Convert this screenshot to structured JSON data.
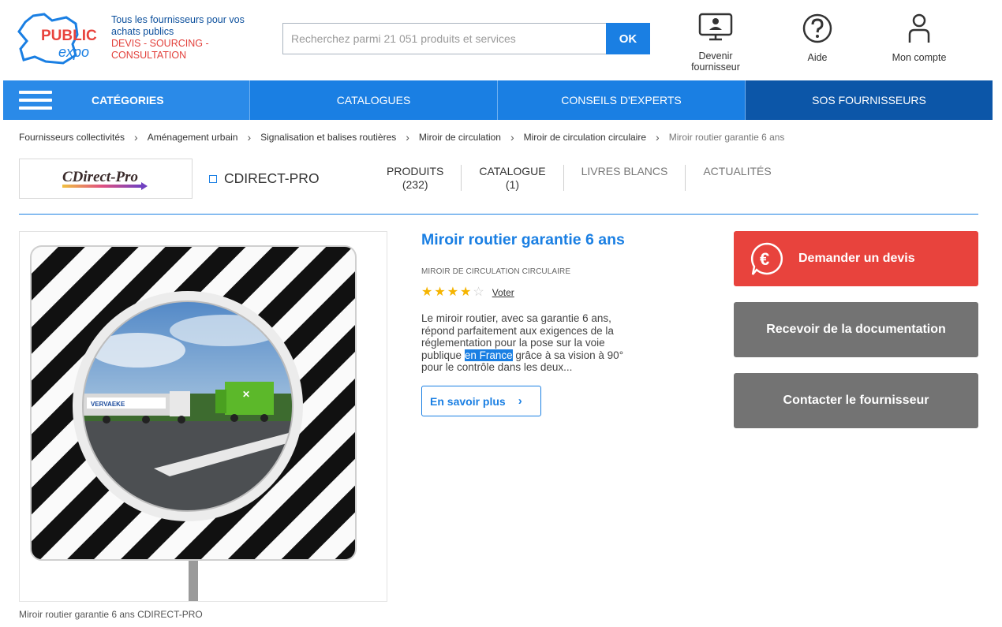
{
  "header": {
    "logo_line1": "PUBLIC",
    "logo_line2": "expo",
    "tagline1": "Tous les fournisseurs pour vos achats publics",
    "tagline2": "DEVIS - SOURCING - CONSULTATION",
    "search_placeholder": "Recherchez parmi 21 051 produits et services",
    "search_button": "OK",
    "links": {
      "become_supplier": "Devenir fournisseur",
      "help": "Aide",
      "account": "Mon compte"
    }
  },
  "nav": {
    "categories": "CATÉGORIES",
    "catalogues": "CATALOGUES",
    "experts": "CONSEILS D'EXPERTS",
    "sos": "SOS FOURNISSEURS"
  },
  "breadcrumb": {
    "b1": "Fournisseurs collectivités",
    "b2": "Aménagement urbain",
    "b3": "Signalisation et balises routières",
    "b4": "Miroir de circulation",
    "b5": "Miroir de circulation circulaire",
    "b6": "Miroir routier garantie 6 ans"
  },
  "supplier": {
    "logo_text": "CDirect-Pro",
    "name": "CDIRECT-PRO",
    "tabs": {
      "products_label": "PRODUITS",
      "products_count": "(232)",
      "catalogue_label": "CATALOGUE",
      "catalogue_count": "(1)",
      "whitepapers": "LIVRES BLANCS",
      "news": "ACTUALITÉS"
    }
  },
  "product": {
    "title": "Miroir routier garantie 6 ans",
    "category": "MIROIR DE CIRCULATION CIRCULAIRE",
    "rating": 4,
    "rating_max": 5,
    "vote_label": "Voter",
    "desc_before": "Le miroir routier, avec sa garantie 6 ans, répond parfaitement aux exigences de la réglementation pour la pose sur la voie publique ",
    "desc_highlight": "en France",
    "desc_after": " grâce à sa vision à 90° pour le contrôle dans les deux...",
    "more_label": "En savoir plus",
    "caption": "Miroir routier garantie 6 ans CDIRECT-PRO",
    "truck_text": "VERVAEKE"
  },
  "actions": {
    "quote": "Demander un devis",
    "documentation": "Recevoir de la documentation",
    "contact": "Contacter le fournisseur"
  },
  "colors": {
    "primary_blue": "#1a7fe3",
    "dark_blue": "#0c56a8",
    "red": "#e8433d",
    "grey_button": "#737373",
    "star": "#f5b400"
  }
}
